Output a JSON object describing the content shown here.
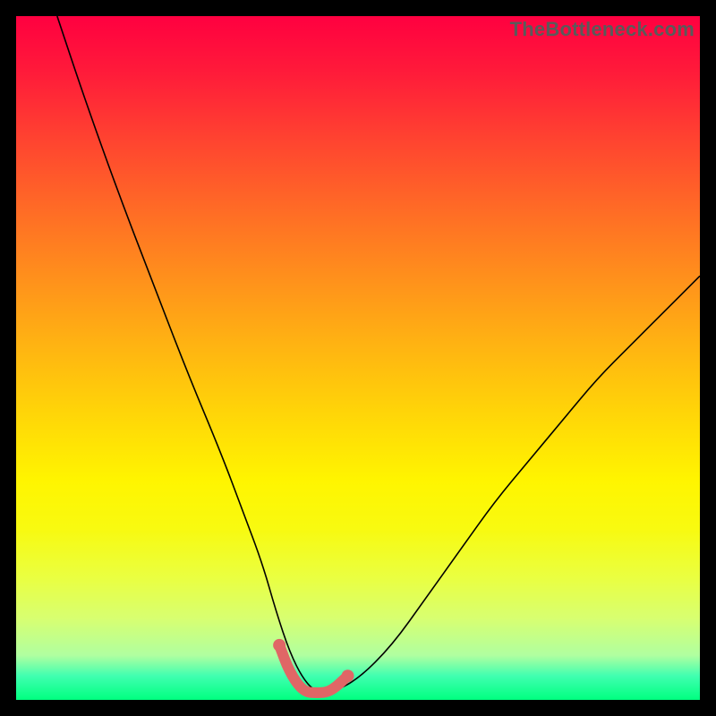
{
  "watermark": "TheBottleneck.com",
  "colors": {
    "gradient_top": "#ff0040",
    "gradient_bottom": "#00ff80",
    "curve_stroke": "#000000",
    "highlight_stroke": "#e06666",
    "frame_bg": "#000000"
  },
  "chart_data": {
    "type": "line",
    "title": "",
    "xlabel": "",
    "ylabel": "",
    "xlim": [
      0,
      100
    ],
    "ylim": [
      0,
      100
    ],
    "grid": false,
    "series": [
      {
        "name": "bottleneck-curve",
        "x": [
          6,
          10,
          15,
          20,
          25,
          30,
          33,
          36,
          38,
          40,
          42,
          44,
          46,
          50,
          55,
          60,
          65,
          70,
          75,
          80,
          85,
          90,
          95,
          100
        ],
        "y": [
          100,
          88,
          74,
          61,
          48,
          36,
          28,
          20,
          13,
          7,
          3,
          1,
          1,
          3,
          8,
          15,
          22,
          29,
          35,
          41,
          47,
          52,
          57,
          62
        ]
      }
    ],
    "highlight": {
      "name": "optimal-region",
      "x": [
        38.5,
        40,
        42,
        44,
        46,
        48.5
      ],
      "y": [
        8,
        4,
        1.2,
        1,
        1.2,
        3.5
      ]
    }
  }
}
